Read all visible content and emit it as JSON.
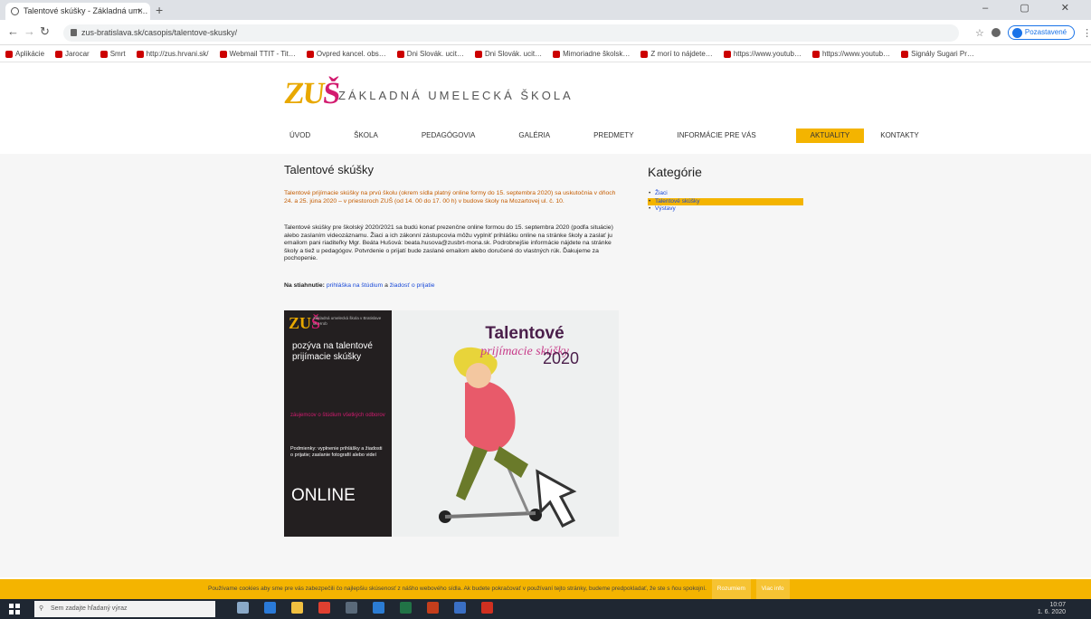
{
  "browser": {
    "tab_title": "Talentové skúšky - Základná um…",
    "tab_close": "×",
    "new_tab": "+",
    "window_controls": "–  ▢  ✕",
    "url": "zus-bratislava.sk/casopis/talentove-skusky/",
    "profile_label": "Pozastavené",
    "bookmarks": [
      "Aplikácie",
      "Jarocar",
      "Smrt",
      "http://zus.hrvani.sk/",
      "Webmail TTIT - Tit…",
      "Ovpred kancel. obs…",
      "Dni Slovák. ucit…",
      "Dni Slovák. ucit…",
      "Mimoriadne školsk…",
      "Z morí to nájdete…",
      "https://www.youtub…",
      "https://www.youtub…",
      "Signály Sugari Pr…"
    ]
  },
  "site": {
    "logo_a": "ZU",
    "logo_b": "Š",
    "school_name": "ZÁKLADNÁ UMELECKÁ ŠKOLA",
    "nav": [
      "ÚVOD",
      "ŠKOLA",
      "PEDAGÓGOVIA",
      "GALÉRIA",
      "PREDMETY",
      "INFORMÁCIE PRE VÁS",
      "AKTUALITY",
      "KONTAKTY"
    ]
  },
  "article": {
    "title": "Talentové skúšky",
    "intro": "Talentové prijímacie skúšky na prvú školu (okrem sídla platný online formy do 15. septembra 2020) sa uskutočnia v dňoch 24. a 25. júna 2020 – v priestoroch ZUŠ (od 14. 00 do 17. 00 h) v budove školy na Mozartovej ul. č. 10.",
    "body": "Talentové skúšky pre školský 2020/2021 sa budú konať prezenčne online formou do 15. septembra 2020 (podľa situácie) alebo zaslaním videozáznamu. Žiaci a ich zákonní zástupcovia môžu vyplniť prihlášku online na stránke školy a zaslať ju emailom pani riaditeľky Mgr. Beáta Hušová: beata.husova@zusbrt-mona.sk. Podrobnejšie informácie nájdete na stránke školy a tiež u pedagógov. Potvrdenie o prijatí bude zaslané emailom alebo doručené do vlastných rúk. Ďakujeme za pochopenie.",
    "download_label": "Na stiahnutie:",
    "download_link1": "prihláška na štúdium",
    "download_and": "a",
    "download_link2": "žiadosť o prijatie"
  },
  "poster": {
    "logo_a": "ZU",
    "logo_b": "Š",
    "small": "Základná umelecká škola v Bratislave ul. Hrob",
    "invite": "pozýva na talentové prijímacie skúšky",
    "pink": "záujemcov o štúdium všetkých odborov",
    "pod": "Podmienky: vyplnenie prihlášky a žiadosti o prijatie; zaslanie fotografií alebo videí",
    "online": "ONLINE",
    "title": "Talentové",
    "subtitle": "prijímacie skúšky",
    "year": "2020"
  },
  "sidebar": {
    "title": "Kategórie",
    "items": [
      "Žiaci",
      "Talentové skúšky",
      "Výstavy"
    ]
  },
  "cookie": {
    "text": "Používame cookies aby sme pre vás zabezpečili čo najlepšiu skúsenosť z nášho webového sídla. Ak budete pokračovať v používaní tejto stránky, budeme predpokladať, že ste s ňou spokojní.",
    "ok": "Rozumiem",
    "more": "Viac info"
  },
  "taskbar": {
    "search_placeholder": "Sem zadajte hľadaný výraz",
    "time": "10:07",
    "date": "1. 6. 2020"
  },
  "colors": {
    "accent": "#f4b400",
    "brand_pink": "#d21b6f",
    "brand_yellow": "#e8a800"
  }
}
